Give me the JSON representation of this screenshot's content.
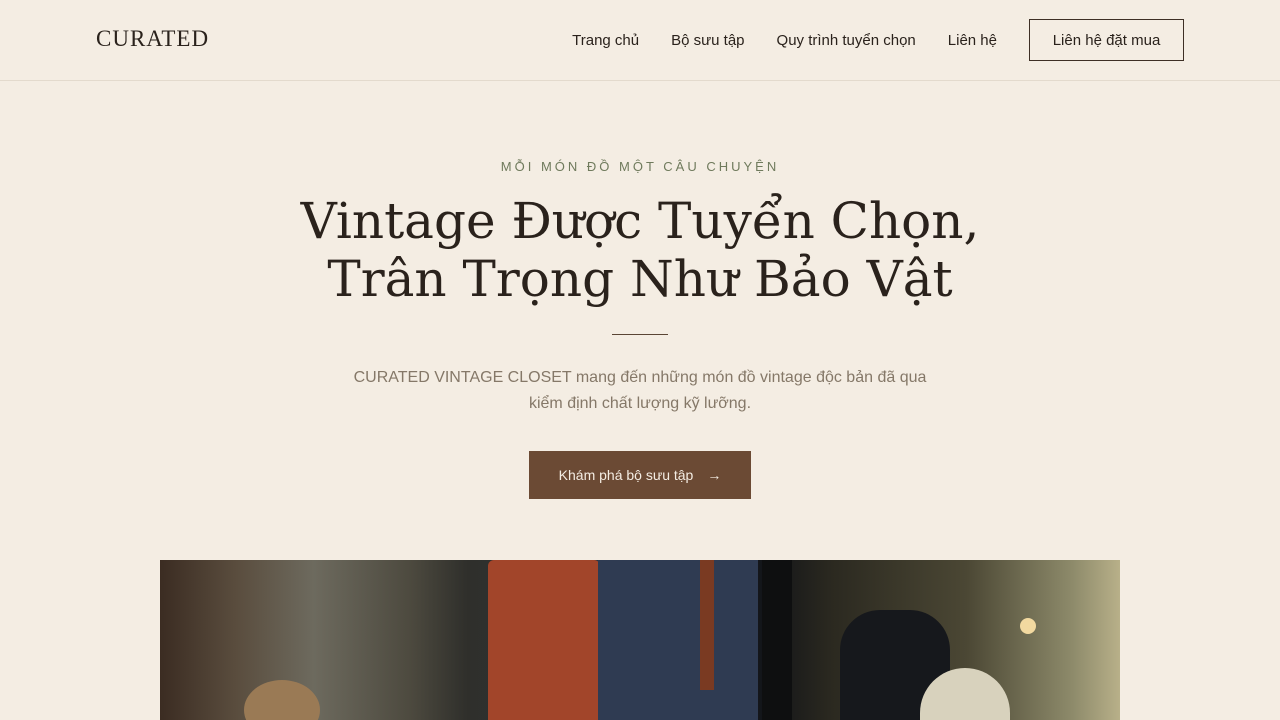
{
  "header": {
    "brand": "CURATED",
    "nav": [
      "Trang chủ",
      "Bộ sưu tập",
      "Quy trình tuyển chọn",
      "Liên hệ"
    ],
    "cta": "Liên hệ đặt mua"
  },
  "hero": {
    "eyebrow": "MỖI MÓN ĐỒ MỘT CÂU CHUYỆN",
    "headline": [
      "Vintage Được Tuyển Chọn,",
      "Trân Trọng Như Bảo Vật"
    ],
    "lead": "CURATED VINTAGE CLOSET mang đến những món đồ vintage độc bản đã qua kiểm định chất lượng kỹ lưỡng.",
    "button_label": "Khám phá bộ sưu tập",
    "button_icon": "arrow-right-icon",
    "button_arrow": "→"
  },
  "colors": {
    "background": "#f4ede3",
    "text": "#2a221c",
    "eyebrow": "#6f7a5c",
    "muted": "#857868",
    "primary_button": "#6b4a34"
  }
}
